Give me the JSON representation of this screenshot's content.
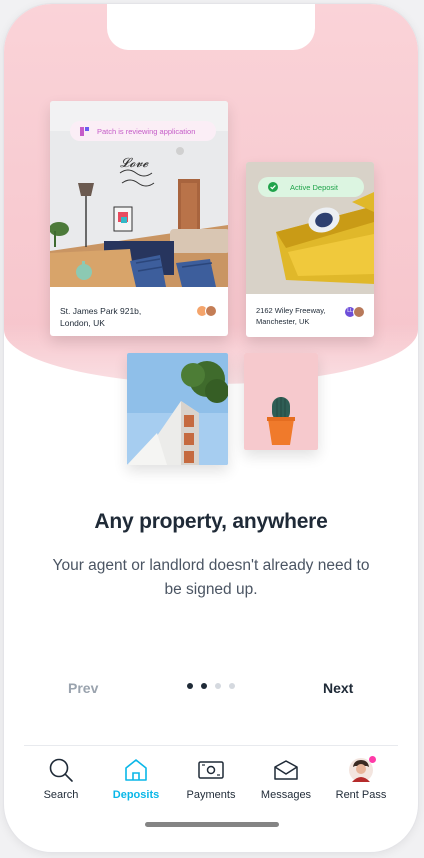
{
  "cards": {
    "card1": {
      "status": "Patch is reviewing application",
      "address_line1": "St. James Park 921b,",
      "address_line2": "London, UK",
      "status_color": "#c55cc8"
    },
    "card2": {
      "status": "Active Deposit",
      "address_line1": "2162 Wiley Freeway,",
      "address_line2": "Manchester, UK",
      "avatar_initials": "LL",
      "status_color": "#1fa34a"
    }
  },
  "onboarding": {
    "title": "Any property, anywhere",
    "subtitle": "Your agent or landlord doesn't already need to be signed up.",
    "prev_label": "Prev",
    "next_label": "Next",
    "page": 2,
    "page_count": 4
  },
  "tabs": [
    {
      "label": "Search",
      "icon": "search-icon"
    },
    {
      "label": "Deposits",
      "icon": "home-icon",
      "active": true
    },
    {
      "label": "Payments",
      "icon": "banknote-icon"
    },
    {
      "label": "Messages",
      "icon": "envelope-icon"
    },
    {
      "label": "Rent Pass",
      "icon": "profile-avatar"
    }
  ],
  "colors": {
    "accent": "#0ab7e8",
    "hero_pink": "#f8cdd3",
    "text_dark": "#1f2a37",
    "notification_dot": "#ff3ba8"
  }
}
